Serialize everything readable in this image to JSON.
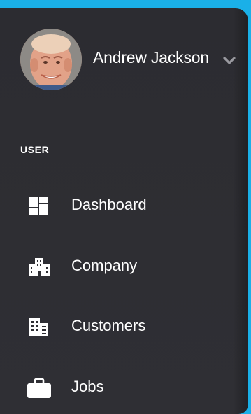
{
  "user": {
    "name": "Andrew Jackson",
    "avatar_icon": "user-avatar-photo",
    "menu_icon": "chevron-down-icon"
  },
  "section": {
    "label": "USER"
  },
  "nav": {
    "items": [
      {
        "label": "Dashboard",
        "icon": "dashboard-icon"
      },
      {
        "label": "Company",
        "icon": "building-icon"
      },
      {
        "label": "Customers",
        "icon": "office-building-icon"
      },
      {
        "label": "Jobs",
        "icon": "briefcase-icon"
      }
    ]
  },
  "colors": {
    "top_bar": "#1ab0e8",
    "sidebar_background": "#2e2e33",
    "divider": "#4a4a50",
    "text": "#ffffff",
    "chevron": "#9a9aa0"
  }
}
